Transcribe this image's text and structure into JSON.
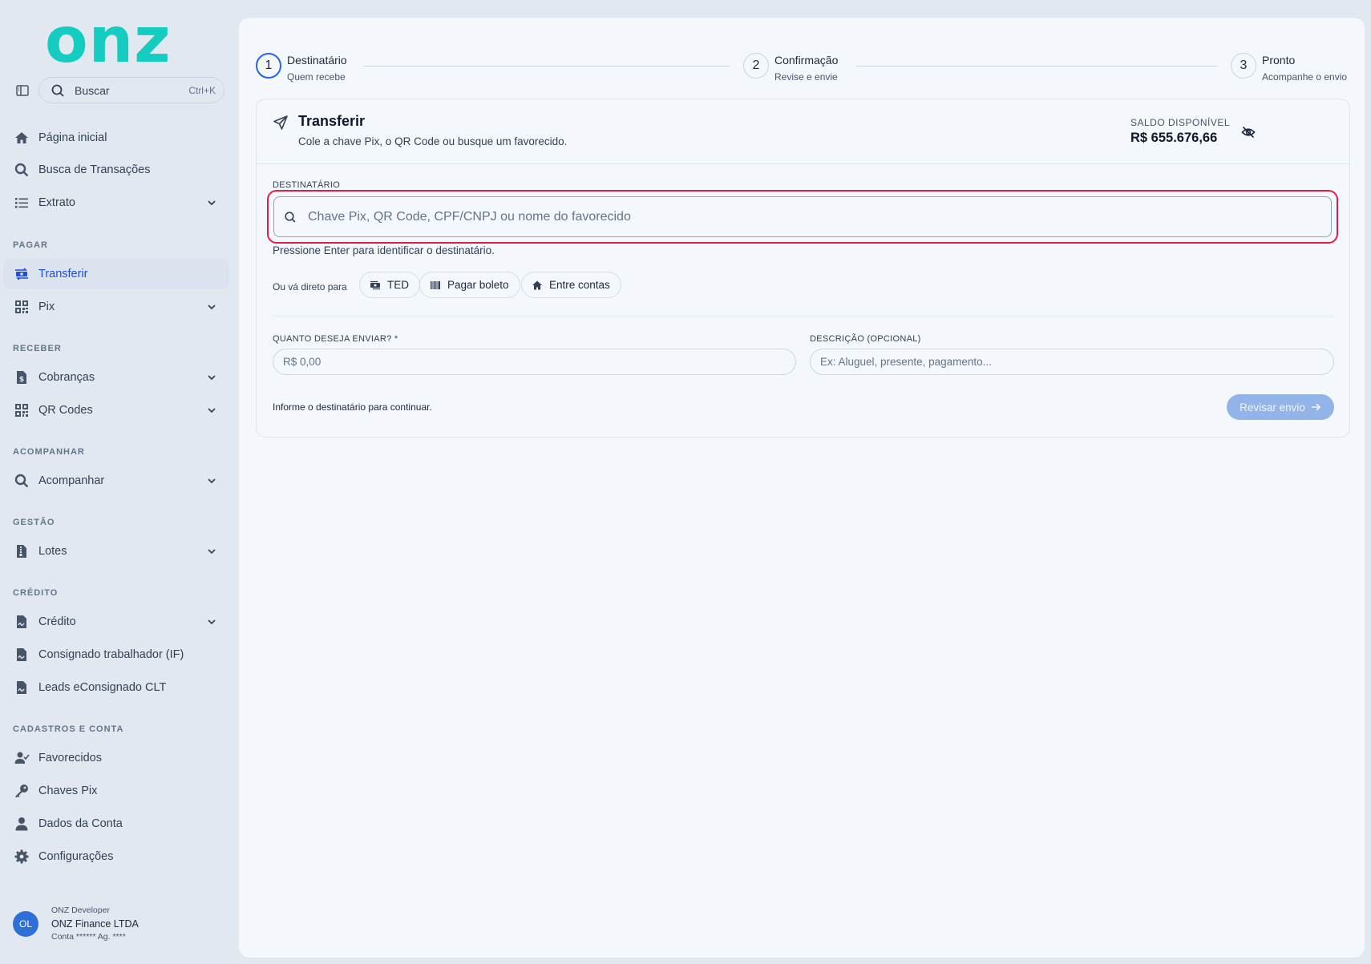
{
  "logo": {
    "text": "onz"
  },
  "search": {
    "label": "Buscar",
    "shortcut": "Ctrl+K"
  },
  "nav": {
    "home": "Página inicial",
    "tx_search": "Busca de Transações",
    "statement": "Extrato",
    "section_pay": "PAGAR",
    "transfer": "Transferir",
    "pix": "Pix",
    "section_receive": "RECEBER",
    "charges": "Cobranças",
    "qrcodes": "QR Codes",
    "section_track": "ACOMPANHAR",
    "track": "Acompanhar",
    "section_mgmt": "GESTÃO",
    "batches": "Lotes",
    "section_credit": "CRÉDITO",
    "credit": "Crédito",
    "payroll": "Consignado trabalhador (IF)",
    "leads": "Leads eConsignado CLT",
    "section_account": "CADASTROS E CONTA",
    "favorites": "Favorecidos",
    "pix_keys": "Chaves Pix",
    "account_data": "Dados da Conta",
    "settings": "Configurações"
  },
  "user": {
    "initials": "OL",
    "role": "ONZ Developer",
    "company": "ONZ Finance LTDA",
    "account": "Conta ****** Ag. ****"
  },
  "stepper": [
    {
      "num": "1",
      "title": "Destinatário",
      "sub": "Quem recebe",
      "current": true
    },
    {
      "num": "2",
      "title": "Confirmação",
      "sub": "Revise e envie"
    },
    {
      "num": "3",
      "title": "Pronto",
      "sub": "Acompanhe o envio"
    }
  ],
  "card": {
    "title": "Transferir",
    "subtitle": "Cole a chave Pix, o QR Code ou busque um favorecido.",
    "balance_label": "SALDO DISPONÍVEL",
    "balance_value": "R$ 655.676,66",
    "recipient_label": "DESTINATÁRIO",
    "recipient_placeholder": "Chave Pix, QR Code, CPF/CNPJ ou nome do favorecido",
    "hint": "Pressione Enter para identificar o destinatário.",
    "shortcut_label": "Ou vá direto para",
    "shortcuts": [
      "TED",
      "Pagar boleto",
      "Entre contas"
    ],
    "amount_label": "QUANTO DESEJA ENVIAR?  *",
    "amount_placeholder": "R$ 0,00",
    "desc_label": "DESCRIÇÃO (OPCIONAL)",
    "desc_placeholder": "Ex: Aluguel, presente, pagamento...",
    "footer_note": "Informe o destinatário para continuar.",
    "review_button": "Revisar envio"
  },
  "colors": {
    "brand": "#14ccc0",
    "primary": "#2563eb",
    "highlight": "#e11d48"
  }
}
